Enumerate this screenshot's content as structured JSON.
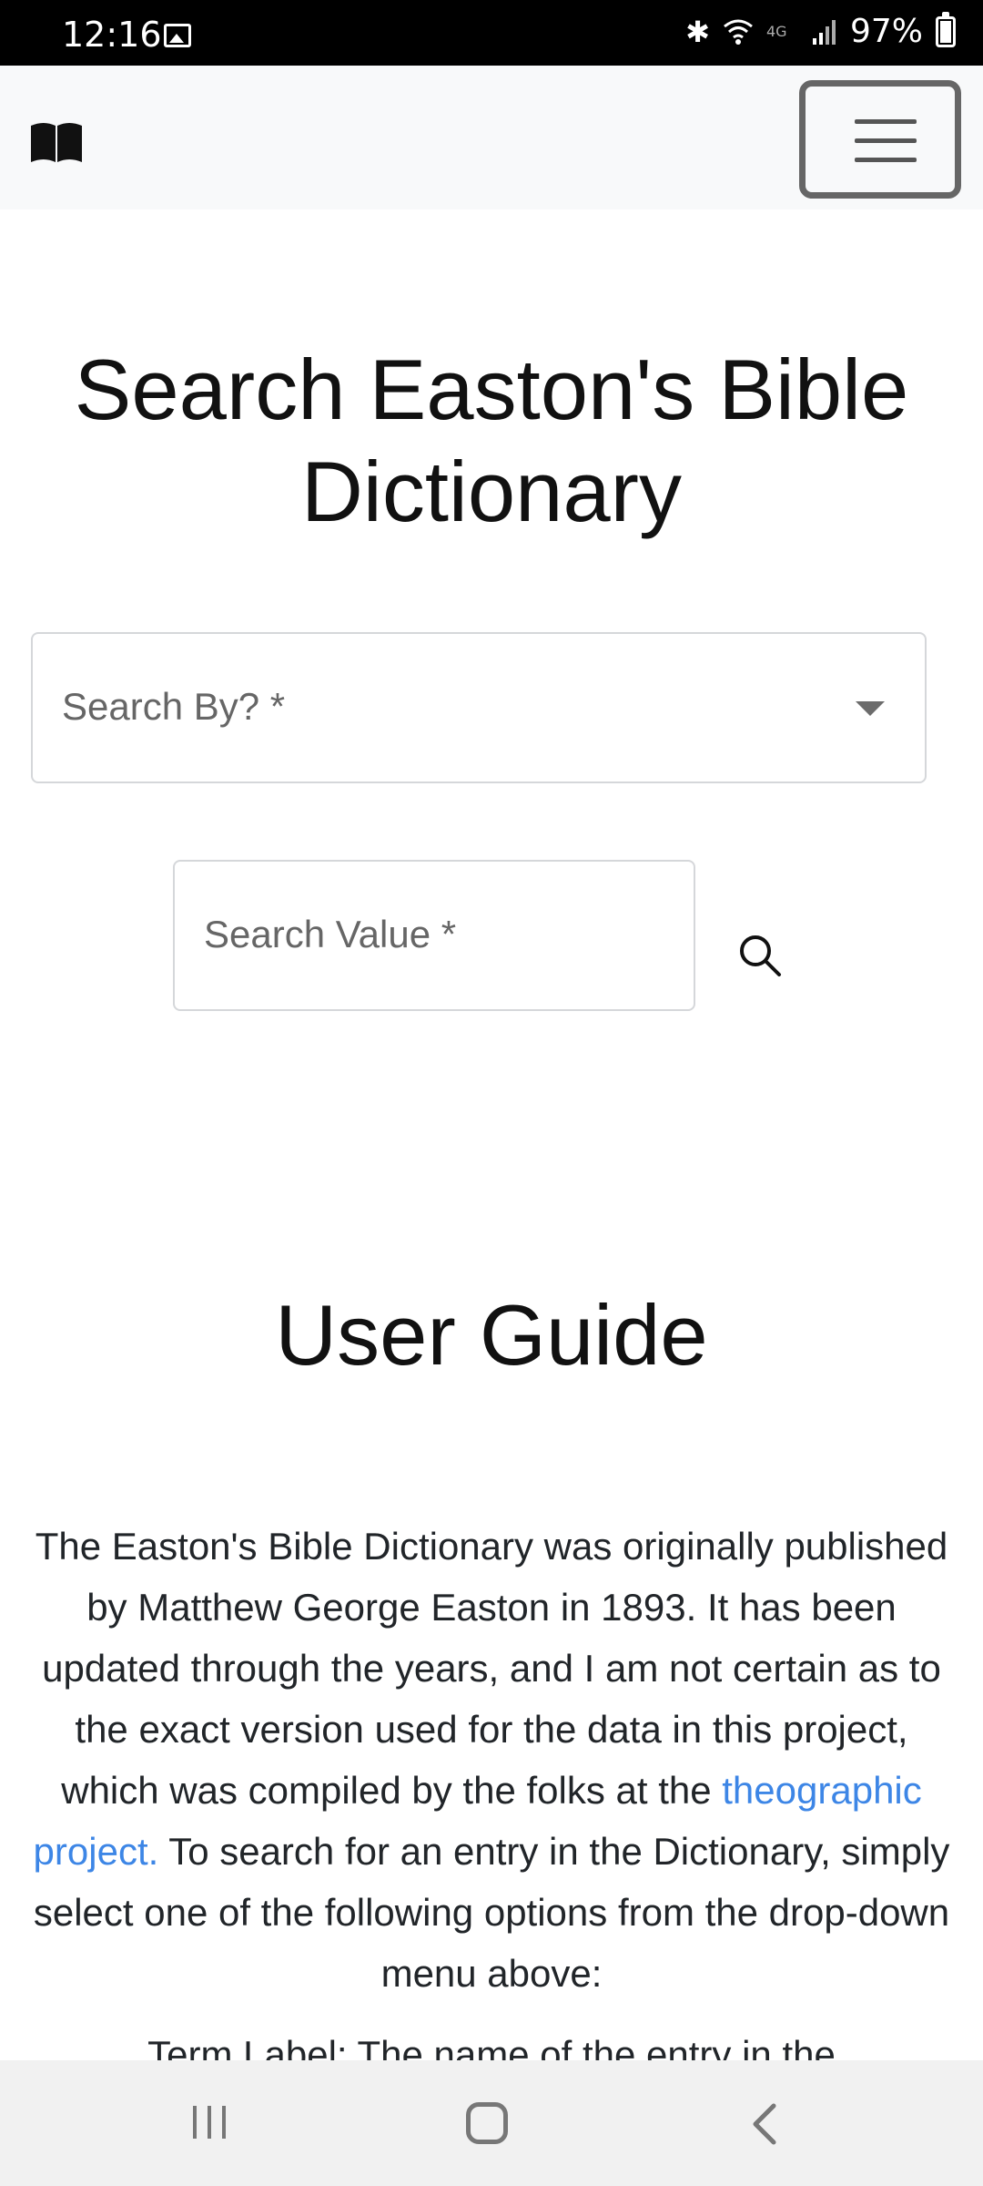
{
  "status_bar": {
    "time": "12:16",
    "battery": "97%",
    "icons": [
      "image-icon",
      "bluetooth-icon",
      "wifi-icon",
      "4g-icon",
      "signal-icon",
      "battery-icon"
    ]
  },
  "navbar": {
    "brand_icon": "book-icon",
    "toggler_icon": "hamburger-menu-icon"
  },
  "search": {
    "title": "Search Easton's Bible Dictionary",
    "search_by_label": "Search By? *",
    "search_value_label": "Search Value *"
  },
  "guide": {
    "title": "User Guide",
    "paragraph_before_link": "The Easton's Bible Dictionary was originally published by Matthew George Easton in 1893. It has been updated through the years, and I am not certain as to the exact version used for the data in this project, which was compiled by the folks at the ",
    "link_text": "theographic project.",
    "paragraph_after_link": " To search for an entry in the Dictionary, simply select one of the following options from the drop-down menu above:",
    "cut_off_line": "Term Label: The name of the entry in the"
  },
  "colors": {
    "link": "#3d86e6",
    "navbar_bg": "#f8f9fa"
  }
}
